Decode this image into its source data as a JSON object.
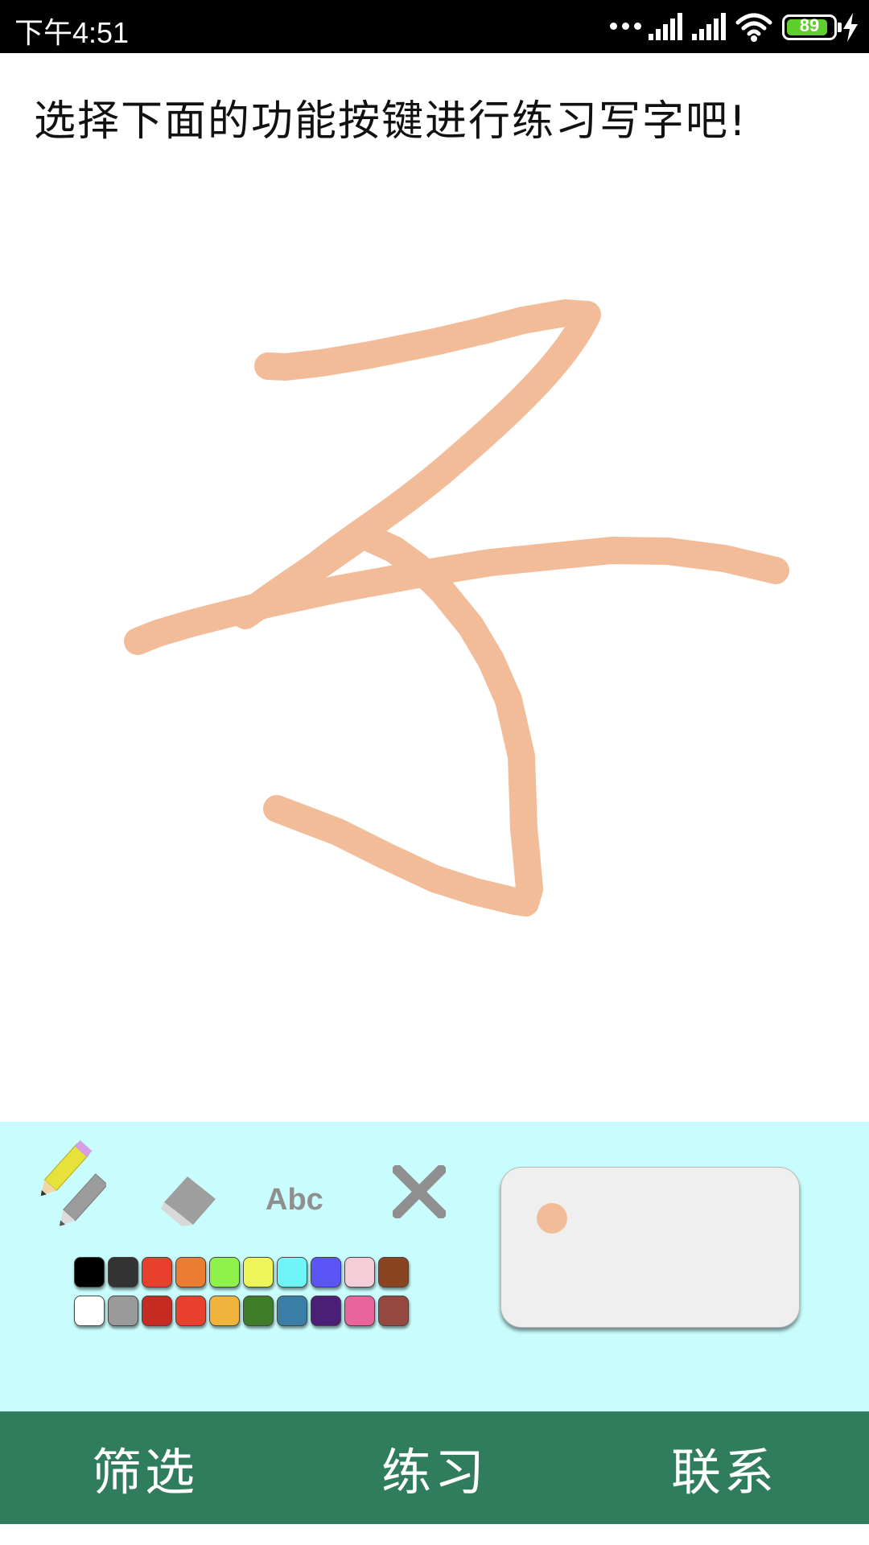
{
  "status_bar": {
    "time": "下午4:51",
    "battery_percent": "89",
    "battery_level": 0.89,
    "icons": [
      "more-dots-icon",
      "signal-icon",
      "signal-icon",
      "wifi-icon",
      "battery-icon",
      "charging-icon"
    ]
  },
  "prompt": "选择下面的功能按键进行练习写字吧!",
  "canvas": {
    "stroke_color": "#f3bc98"
  },
  "tools": {
    "pencil_icon": "pencil-icon",
    "eraser_icon": "eraser-icon",
    "text_tool": "Abc",
    "clear_icon": "close-icon"
  },
  "palette": {
    "row1": [
      "#000000",
      "#333333",
      "#e8402c",
      "#ea7d31",
      "#8ff24a",
      "#eef55a",
      "#6ff5f7",
      "#5c55f6",
      "#f3cdd7",
      "#8a4520"
    ],
    "row2": [
      "#ffffff",
      "#9a9a9a",
      "#c52b21",
      "#e8402c",
      "#f0b43d",
      "#3e7c2a",
      "#3a7ea6",
      "#4a1f75",
      "#e9649b",
      "#94483f"
    ]
  },
  "preview": {
    "brush_color": "#f3bc98"
  },
  "bottom_nav": {
    "items": [
      {
        "label": "筛选"
      },
      {
        "label": "练习"
      },
      {
        "label": "联系"
      }
    ],
    "background": "#2f7d5d"
  }
}
